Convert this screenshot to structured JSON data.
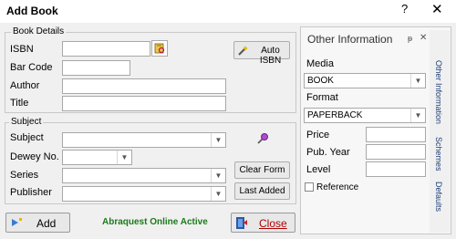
{
  "window": {
    "title": "Add Book",
    "help": "?",
    "close": "✕"
  },
  "book_details": {
    "legend": "Book Details",
    "isbn_label": "ISBN",
    "isbn_value": "",
    "auto_isbn_label": "Auto ISBN",
    "barcode_label": "Bar Code",
    "barcode_value": "",
    "author_label": "Author",
    "author_value": "",
    "title_label": "Title",
    "title_value": ""
  },
  "subject_group": {
    "legend": "Subject",
    "subject_label": "Subject",
    "subject_value": "",
    "dewey_label": "Dewey No.",
    "dewey_value": "",
    "series_label": "Series",
    "series_value": "",
    "publisher_label": "Publisher",
    "publisher_value": "",
    "clear_form_label": "Clear Form",
    "last_added_label": "Last Added"
  },
  "footer": {
    "add_label": "Add",
    "status": "Abraquest Online Active",
    "status_color": "#1a7a1a",
    "close_label": "Close"
  },
  "other_info": {
    "heading": "Other Information",
    "pin": "ᵽ",
    "close": "✕",
    "media_label": "Media",
    "media_value": "BOOK",
    "format_label": "Format",
    "format_value": "PAPERBACK",
    "price_label": "Price",
    "price_value": "",
    "pubyear_label": "Pub. Year",
    "pubyear_value": "",
    "level_label": "Level",
    "level_value": "",
    "reference_label": "Reference",
    "reference_checked": false,
    "tabs": [
      "Other Information",
      "Schemes",
      "Defaults"
    ]
  },
  "icons": {
    "isbn_lookup": "book-search-icon",
    "auto_isbn": "wand-icon",
    "subject_search": "magnifier-icon",
    "add": "add-arrow-icon",
    "close": "exit-door-icon"
  }
}
